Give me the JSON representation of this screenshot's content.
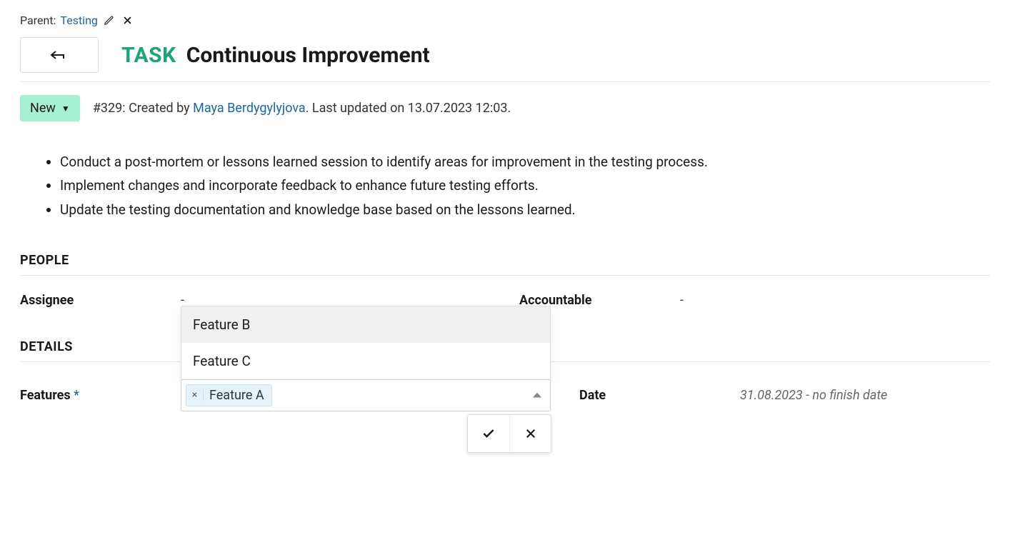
{
  "parent": {
    "label": "Parent:",
    "link_text": "Testing"
  },
  "header": {
    "type_label": "TASK",
    "title": "Continuous Improvement"
  },
  "status": {
    "label": "New"
  },
  "meta": {
    "id_prefix": "#329:",
    "created_by_label": "Created by",
    "author": "Maya Berdygylyjova",
    "updated_text": ". Last updated on 13.07.2023 12:03."
  },
  "description": {
    "bullets": [
      "Conduct a post-mortem or lessons learned session to identify areas for improvement in the testing process.",
      "Implement changes and incorporate feedback to enhance future testing efforts.",
      "Update the testing documentation and knowledge base based on the lessons learned."
    ]
  },
  "sections": {
    "people": "PEOPLE",
    "details": "DETAILS"
  },
  "fields": {
    "assignee": {
      "label": "Assignee",
      "value": "-"
    },
    "accountable": {
      "label": "Accountable",
      "value": "-"
    },
    "features": {
      "label": "Features",
      "required_marker": "*"
    },
    "date": {
      "label": "Date",
      "value": "31.08.2023 - no finish date"
    }
  },
  "features_editor": {
    "options": [
      {
        "label": "Feature B",
        "highlighted": true
      },
      {
        "label": "Feature C",
        "highlighted": false
      }
    ],
    "selected": [
      {
        "label": "Feature A"
      }
    ]
  }
}
